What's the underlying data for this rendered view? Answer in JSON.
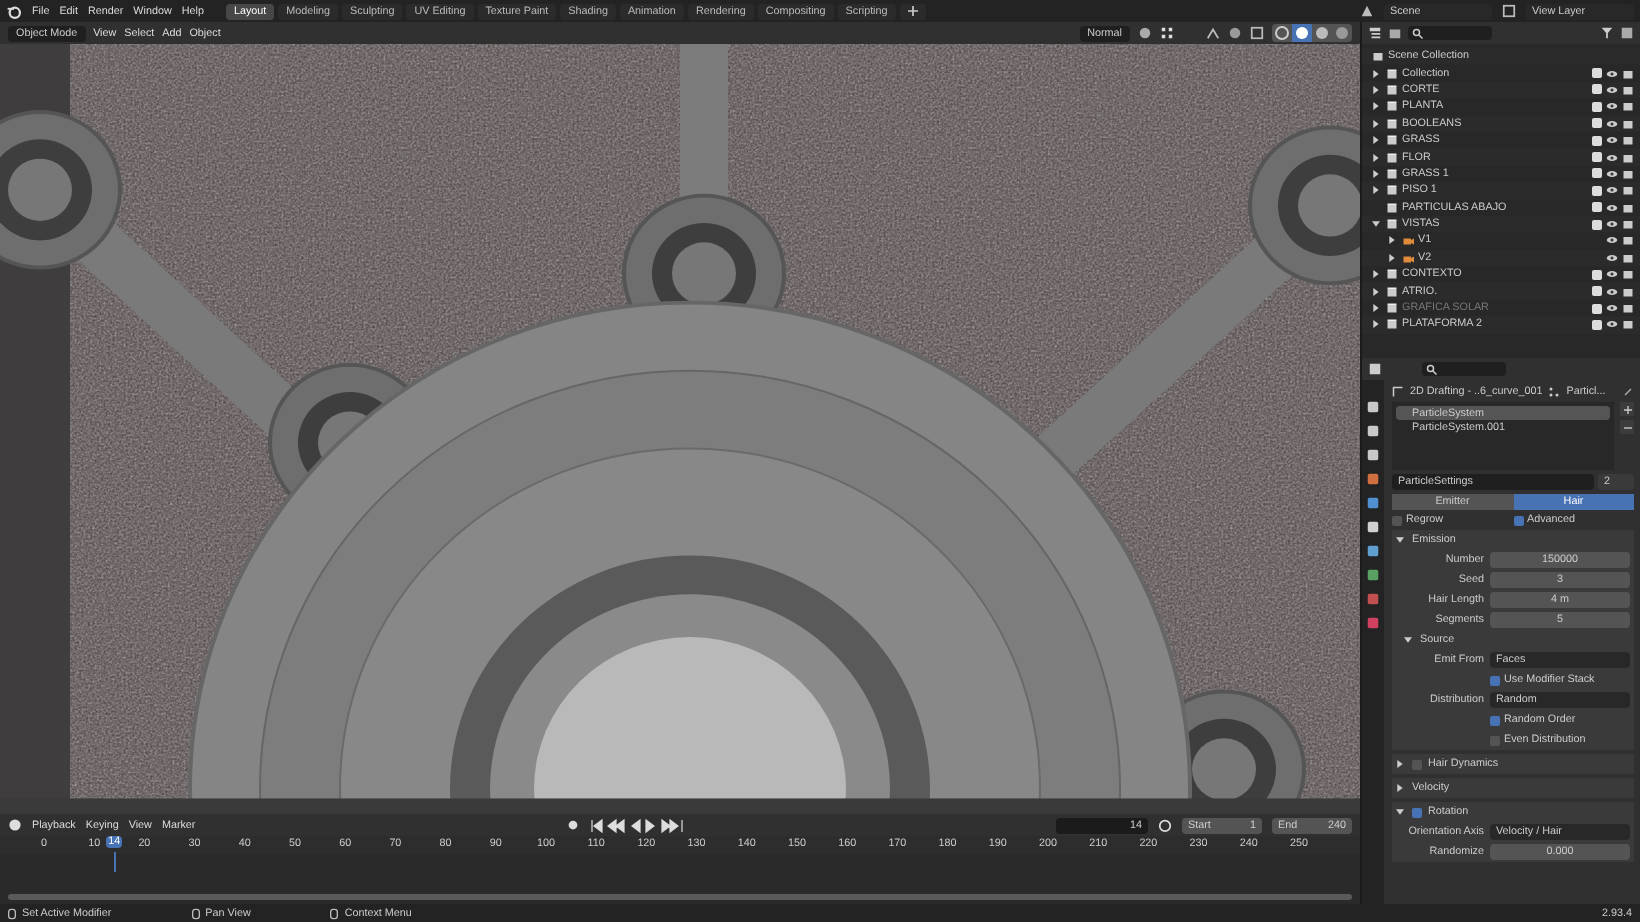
{
  "menu": [
    "File",
    "Edit",
    "Render",
    "Window",
    "Help"
  ],
  "workspaces": [
    {
      "label": "Layout",
      "selected": true
    },
    {
      "label": "Modeling",
      "selected": false
    },
    {
      "label": "Sculpting",
      "selected": false
    },
    {
      "label": "UV Editing",
      "selected": false
    },
    {
      "label": "Texture Paint",
      "selected": false
    },
    {
      "label": "Shading",
      "selected": false
    },
    {
      "label": "Animation",
      "selected": false
    },
    {
      "label": "Rendering",
      "selected": false
    },
    {
      "label": "Compositing",
      "selected": false
    },
    {
      "label": "Scripting",
      "selected": false
    }
  ],
  "scene": "Scene",
  "view_layer": "View Layer",
  "viewport_header": {
    "mode": "Object Mode",
    "menus": [
      "View",
      "Select",
      "Add",
      "Object"
    ],
    "orientation": "Normal"
  },
  "outliner": {
    "root": "Scene Collection",
    "items": [
      {
        "name": "Collection",
        "kind": "collection",
        "expanded": false,
        "checked": true,
        "disabled": false
      },
      {
        "name": "CORTE",
        "kind": "collection",
        "expanded": false,
        "checked": true,
        "disabled": false
      },
      {
        "name": "PLANTA",
        "kind": "collection",
        "expanded": false,
        "checked": true,
        "disabled": false
      },
      {
        "name": "BOOLEANS",
        "kind": "collection",
        "expanded": false,
        "checked": true,
        "disabled": false
      },
      {
        "name": "GRASS",
        "kind": "collection",
        "expanded": false,
        "checked": true,
        "disabled": false
      },
      {
        "name": "FLOR",
        "kind": "collection",
        "expanded": false,
        "checked": true,
        "disabled": false
      },
      {
        "name": "GRASS 1",
        "kind": "collection",
        "expanded": false,
        "checked": true,
        "disabled": false
      },
      {
        "name": "PISO 1",
        "kind": "collection",
        "expanded": false,
        "checked": true,
        "disabled": false
      },
      {
        "name": "PARTICULAS ABAJO",
        "kind": "collection",
        "checked": true,
        "disabled": false
      },
      {
        "name": "VISTAS",
        "kind": "collection",
        "expanded": true,
        "checked": true,
        "disabled": false,
        "children": [
          {
            "name": "V1",
            "kind": "camera",
            "expanded": false,
            "disabled": false
          },
          {
            "name": "V2",
            "kind": "camera",
            "expanded": false,
            "disabled": false
          }
        ]
      },
      {
        "name": "CONTEXTO",
        "kind": "collection",
        "expanded": false,
        "checked": true,
        "disabled": false
      },
      {
        "name": "ATRIO.",
        "kind": "collection",
        "expanded": false,
        "checked": true,
        "disabled": false
      },
      {
        "name": "GRAFICA SOLAR",
        "kind": "collection",
        "expanded": false,
        "checked": true,
        "disabled": true
      },
      {
        "name": "PLATAFORMA 2",
        "kind": "collection",
        "expanded": false,
        "checked": true,
        "disabled": false
      }
    ]
  },
  "properties": {
    "object": "2D Drafting - ..6_curve_001",
    "modifier": "Particl...",
    "systems": [
      {
        "name": "ParticleSystem",
        "selected": true
      },
      {
        "name": "ParticleSystem.001",
        "selected": false
      }
    ],
    "settings": "ParticleSettings",
    "users": "2",
    "types": [
      {
        "label": "Emitter",
        "selected": false
      },
      {
        "label": "Hair",
        "selected": true
      }
    ],
    "options": [
      {
        "label": "Regrow",
        "checked": false
      },
      {
        "label": "Advanced",
        "checked": true
      }
    ],
    "emission": {
      "title": "Emission",
      "expanded": true,
      "fields": [
        {
          "label": "Number",
          "value": "150000"
        },
        {
          "label": "Seed",
          "value": "3"
        },
        {
          "label": "Hair Length",
          "value": "4 m"
        },
        {
          "label": "Segments",
          "value": "5"
        }
      ]
    },
    "source": {
      "title": "Source",
      "expanded": true,
      "rows": [
        {
          "kind": "dropdown",
          "label": "Emit From",
          "value": "Faces"
        },
        {
          "kind": "checkbox",
          "label": "Use Modifier Stack",
          "checked": true
        },
        {
          "kind": "dropdown",
          "label": "Distribution",
          "value": "Random"
        },
        {
          "kind": "checkbox",
          "label": "Random Order",
          "checked": true
        },
        {
          "kind": "checkbox",
          "label": "Even Distribution",
          "checked": false
        }
      ]
    },
    "panels": [
      {
        "title": "Hair Dynamics",
        "expanded": false,
        "checked": false
      },
      {
        "title": "Velocity",
        "expanded": false
      },
      {
        "title": "Rotation",
        "expanded": true,
        "checked": true
      }
    ],
    "rotation_rows": [
      {
        "kind": "dropdown",
        "label": "Orientation Axis",
        "value": "Velocity / Hair"
      },
      {
        "kind": "field",
        "label": "Randomize",
        "value": "0.000"
      }
    ]
  },
  "timeline": {
    "menus": [
      "Playback",
      "Keying",
      "View",
      "Marker"
    ],
    "current": "14",
    "start_label": "Start",
    "start": "1",
    "end_label": "End",
    "end": "240",
    "ticks": [
      "0",
      "10",
      "20",
      "30",
      "40",
      "50",
      "60",
      "70",
      "80",
      "90",
      "100",
      "110",
      "120",
      "130",
      "140",
      "150",
      "160",
      "170",
      "180",
      "190",
      "200",
      "210",
      "220",
      "230",
      "240",
      "250"
    ],
    "playhead": "14"
  },
  "status": [
    "Set Active Modifier",
    "Pan View",
    "Context Menu"
  ],
  "version": "2.93.4"
}
